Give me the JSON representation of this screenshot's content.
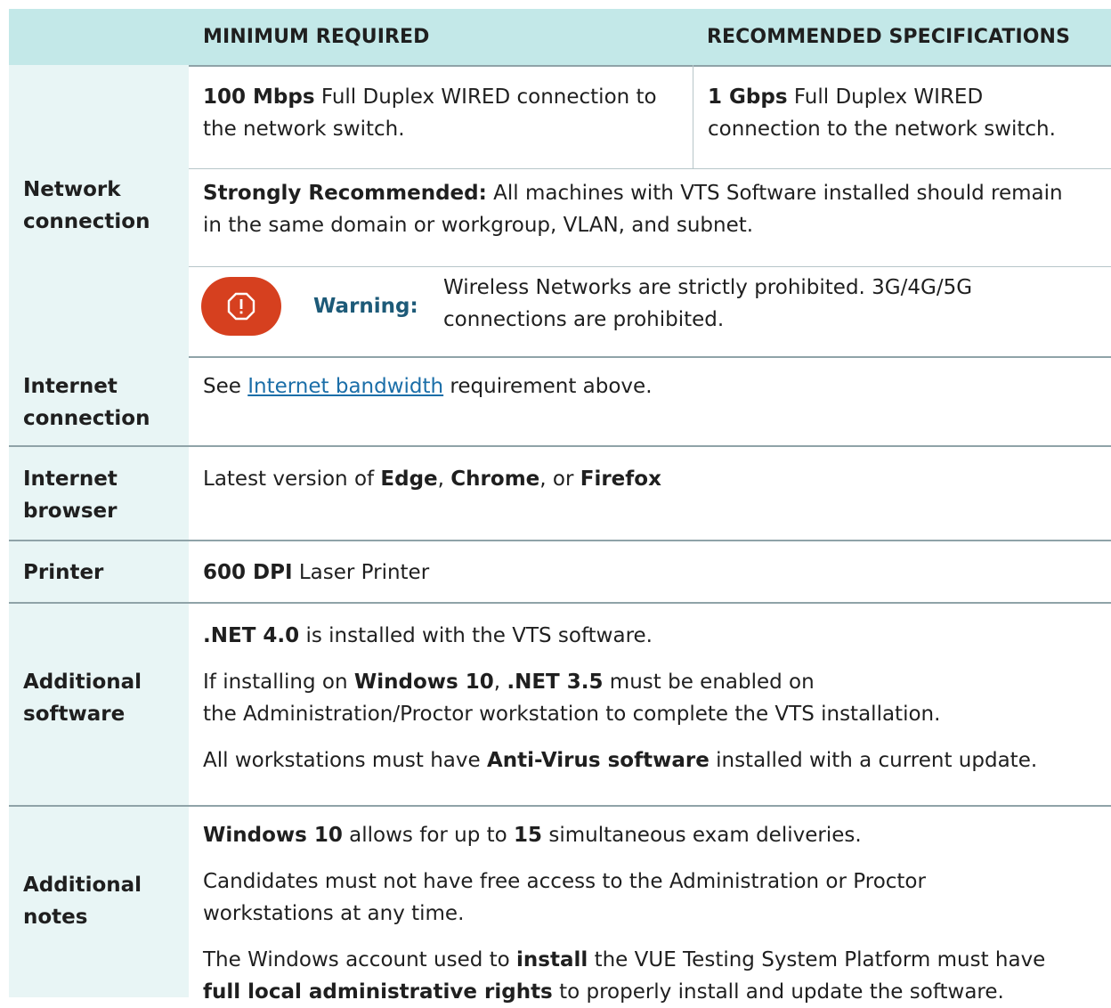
{
  "header": {
    "minimum": "MINIMUM REQUIRED",
    "recommended": "RECOMMENDED SPECIFICATIONS"
  },
  "network": {
    "label_line1": "Network",
    "label_line2": "connection",
    "min_bold": "100 Mbps",
    "min_text_1": " Full Duplex WIRED connection to",
    "min_text_2": "the network switch.",
    "rec_bold": "1 Gbps",
    "rec_text_1": " Full Duplex WIRED",
    "rec_text_2": "connection to the network switch.",
    "strong_bold": "Strongly Recommended:",
    "strong_text_1": " All machines with VTS Software installed should remain",
    "strong_text_2": "in the same domain or workgroup, VLAN, and subnet.",
    "warning_label": "Warning:",
    "warning_text_1": "Wireless Networks are strictly prohibited. 3G/4G/5G",
    "warning_text_2": "connections are prohibited.",
    "warning_icon": "warning-octagon-icon"
  },
  "internet_connection": {
    "label_line1": "Internet",
    "label_line2": "connection",
    "pre": "See ",
    "link": "Internet bandwidth",
    "post": " requirement above."
  },
  "internet_browser": {
    "label_line1": "Internet",
    "label_line2": "browser",
    "pre": "Latest version of ",
    "b1": "Edge",
    "sep1": ", ",
    "b2": "Chrome",
    "sep2": ", or ",
    "b3": "Firefox"
  },
  "printer": {
    "label": "Printer",
    "bold": "600 DPI",
    "text": " Laser Printer"
  },
  "additional_software": {
    "label_line1": "Additional",
    "label_line2": "software",
    "p1_bold": ".NET 4.0",
    "p1_text": " is installed with the VTS software.",
    "p2_pre": "If installing on ",
    "p2_b1": "Windows 10",
    "p2_sep": ", ",
    "p2_b2": ".NET 3.5",
    "p2_text_1": " must be enabled on",
    "p2_text_2": "the Administration/Proctor workstation to complete the VTS installation.",
    "p3_pre": "All workstations must have ",
    "p3_bold": "Anti-Virus software",
    "p3_post": " installed with a current update."
  },
  "additional_notes": {
    "label_line1": "Additional",
    "label_line2": "notes",
    "p1_b1": "Windows 10",
    "p1_text": " allows for up to ",
    "p1_b2": "15",
    "p1_post": " simultaneous exam deliveries.",
    "p2_line1": "Candidates must not have free access to the Administration or Proctor",
    "p2_line2": "workstations at any time.",
    "p3_pre": "The Windows account used to ",
    "p3_b1": "install",
    "p3_mid": " the VUE Testing System Platform must have",
    "p3_b2": "full local administrative rights",
    "p3_post": " to properly install and update the software."
  },
  "colors": {
    "header_bg": "#c3e8e8",
    "label_bg": "#e8f5f5",
    "warning_red": "#d6401f",
    "warning_title": "#1d5a78",
    "link": "#1b6ea8"
  }
}
